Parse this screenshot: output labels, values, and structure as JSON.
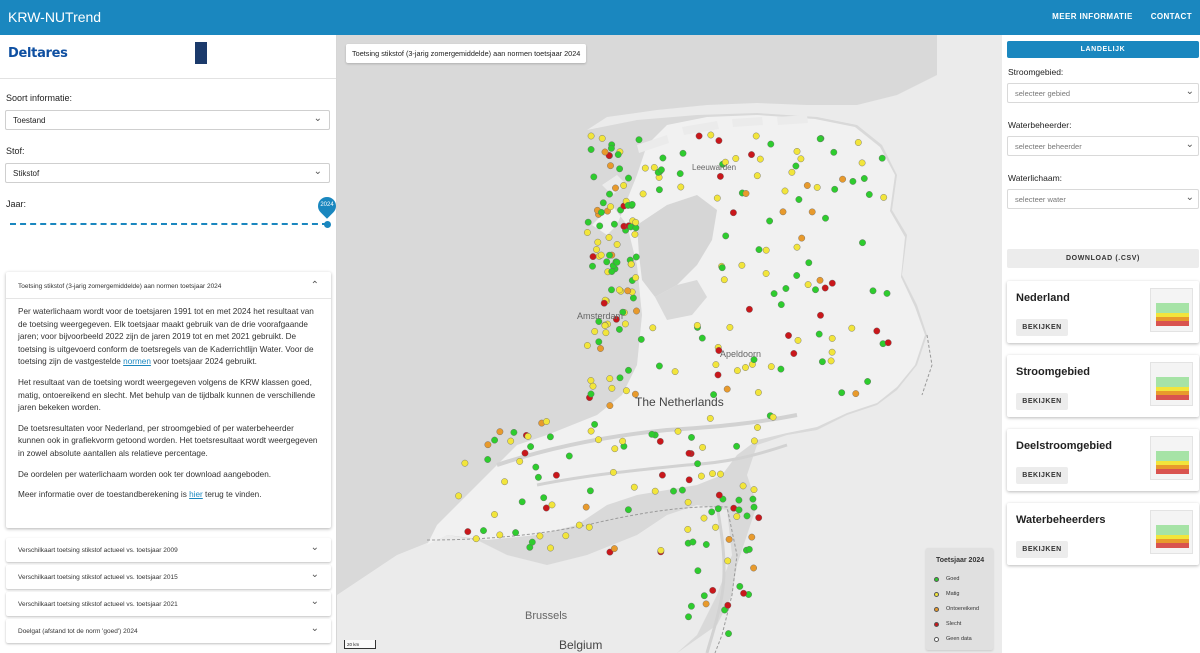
{
  "header": {
    "app_title": "KRW-NUTrend",
    "nav": [
      {
        "label": "MEER INFORMATIE"
      },
      {
        "label": "CONTACT"
      }
    ],
    "color": "#1a87bf"
  },
  "left_panel": {
    "logo_deltares": "Deltares",
    "fields": {
      "soort_label": "Soort informatie:",
      "soort_value": "Toestand",
      "stof_label": "Stof:",
      "stof_value": "Stikstof",
      "jaar_label": "Jaar:",
      "jaar_value": "2024"
    },
    "accordion_open": {
      "title": "Toetsing stikstof (3-jarig zomergemiddelde) aan normen toetsjaar 2024",
      "p1_a": "Per waterlichaam wordt voor de toetsjaren 1991 tot en met 2024 het resultaat van de toetsing weergegeven. Elk toetsjaar maakt gebruik van de drie voorafgaande jaren; voor bijvoorbeeld 2022 zijn de jaren 2019 tot en met 2021 gebruikt. De toetsing is uitgevoerd conform de toetsregels van de Kaderrichtlijn Water. Voor de toetsing zijn de vastgestelde ",
      "p1_link": "normen",
      "p1_b": " voor toetsjaar 2024 gebruikt.",
      "p2": "Het resultaat van de toetsing wordt weergegeven volgens de KRW klassen goed, matig, ontoereikend en slecht. Met behulp van de tijdbalk kunnen de verschillende jaren bekeken worden.",
      "p3": "De toetsresultaten voor Nederland, per stroomgebied of per waterbeheerder kunnen ook in grafiekvorm getoond worden. Het toetsresultaat wordt weergegeven in zowel absolute aantallen als relatieve percentage.",
      "p4": "De oordelen per waterlichaam worden ook ter download aangeboden.",
      "p5_a": "Meer informatie over de toestandberekening is ",
      "p5_link": "hier",
      "p5_b": " terug te vinden."
    },
    "accordion_closed": [
      {
        "label": "Verschilkaart toetsing stikstof actueel vs. toetsjaar 2009"
      },
      {
        "label": "Verschilkaart toetsing stikstof actueel vs. toetsjaar 2015"
      },
      {
        "label": "Verschilkaart toetsing stikstof actueel vs. toetsjaar 2021"
      },
      {
        "label": "Doelgat (afstand tot de norm 'goed') 2024"
      }
    ]
  },
  "map": {
    "title": "Toetsing stikstof (3-jarig zomergemiddelde) aan normen toetsjaar 2024",
    "labels": {
      "amsterdam": "Amsterdam",
      "apeldoorn": "Apeldoorn",
      "the_netherlands": "The Netherlands",
      "leeuwarden": "Leeuwarden",
      "brussels": "Brussels",
      "belgium": "Belgium"
    },
    "scale": "20 km",
    "legend": {
      "title": "Toetsjaar 2024",
      "items": [
        {
          "label": "Goed",
          "color": "#2ecc2e"
        },
        {
          "label": "Matig",
          "color": "#f2e53b"
        },
        {
          "label": "Ontoereikend",
          "color": "#e89a2c"
        },
        {
          "label": "Slecht",
          "color": "#c9171b"
        },
        {
          "label": "Geen data",
          "color": "#ffffff"
        }
      ]
    }
  },
  "right_panel": {
    "landelijk": "LANDELIJK",
    "stroomgebied_label": "Stroomgebied:",
    "stroomgebied_placeholder": "selecteer gebied",
    "waterbeheerder_label": "Waterbeheerder:",
    "waterbeheerder_placeholder": "selecteer beheerder",
    "waterlichaam_label": "Waterlichaam:",
    "waterlichaam_placeholder": "selecteer water",
    "download": "DOWNLOAD (.CSV)",
    "cards": [
      {
        "title": "Nederland",
        "button": "BEKIJKEN"
      },
      {
        "title": "Stroomgebied",
        "button": "BEKIJKEN"
      },
      {
        "title": "Deelstroomgebied",
        "button": "BEKIJKEN"
      },
      {
        "title": "Waterbeheerders",
        "button": "BEKIJKEN"
      }
    ]
  }
}
